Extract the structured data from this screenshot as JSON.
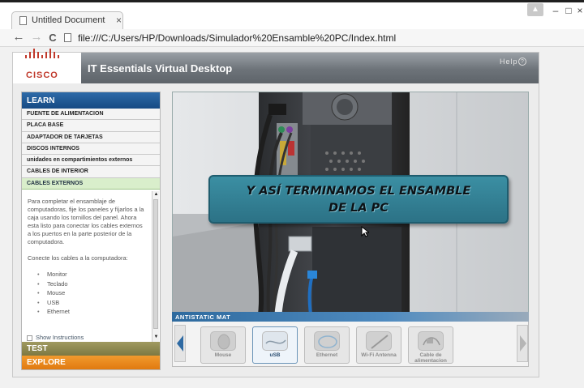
{
  "browser": {
    "tab_title": "Untitled Document",
    "tab_close": "×",
    "url": "file:///C:/Users/HP/Downloads/Simulador%20Ensamble%20PC/Index.html",
    "back": "←",
    "forward": "→",
    "reload": "C",
    "minimize": "–",
    "maximize": "□",
    "close": "×"
  },
  "app": {
    "logo_text": "CISCO",
    "title": "IT Essentials Virtual Desktop",
    "help_label": "Help",
    "help_icon": "?"
  },
  "left_panel": {
    "learn_label": "LEARN",
    "menu": [
      "FUENTE DE ALIMENTACION",
      "PLACA BASE",
      "ADAPTADOR DE TARJETAS",
      "DISCOS INTERNOS",
      "unidades en compartimientos externos",
      "CABLES DE INTERIOR",
      "CABLES EXTERNOS"
    ],
    "selected_index": 6,
    "instructions": {
      "para1": "Para completar el ensamblaje de computadoras, fije los paneles y fíjarlos a la caja usando los tornillos del panel. Ahora esta listo para conectar los cables externos a los puertos en la parte posterior de la computadora.",
      "para2": "Conecte los cables a la computadora:",
      "items": [
        "Monitor",
        "Teclado",
        "Mouse",
        "USB",
        "Ethernet"
      ]
    },
    "show_instructions": "Show Instructions",
    "test_label": "TEST",
    "explore_label": "EXPLORE"
  },
  "viewer": {
    "banner_line1": "Y ASÍ TERMINAMOS EL ENSAMBLE",
    "banner_line2": "DE LA PC",
    "mat_label": "ANTISTATIC MAT"
  },
  "tray": {
    "items": [
      {
        "label": "Mouse",
        "icon": "mouse-icon"
      },
      {
        "label": "uSB",
        "icon": "usb-cable-icon",
        "selected": true
      },
      {
        "label": "Ethernet",
        "icon": "ethernet-cable-icon"
      },
      {
        "label": "Wi-Fi Antenna",
        "icon": "antenna-icon"
      },
      {
        "label": "Cable de alimentacion",
        "icon": "power-cable-icon"
      }
    ]
  },
  "colors": {
    "learn_blue": "#1d5797",
    "test_olive": "#8c8650",
    "explore_orange": "#e8851e",
    "banner_teal": "#3382a0",
    "cisco_red": "#c0392b"
  }
}
